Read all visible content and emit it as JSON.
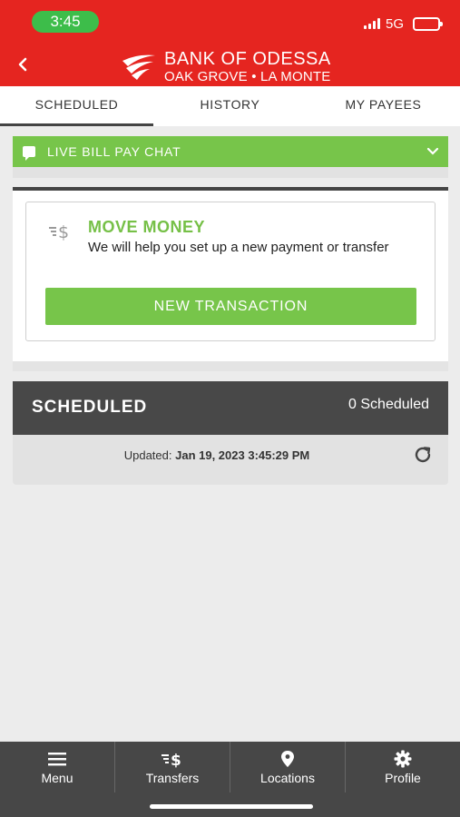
{
  "status_bar": {
    "time": "3:45",
    "network": "5G"
  },
  "header": {
    "bank_name": "BANK OF ODESSA",
    "bank_locations": "OAK GROVE • LA MONTE",
    "back_icon": "chevron-left-icon"
  },
  "tabs": [
    {
      "label": "SCHEDULED",
      "active": true
    },
    {
      "label": "HISTORY",
      "active": false
    },
    {
      "label": "MY PAYEES",
      "active": false
    }
  ],
  "chat": {
    "label": "LIVE BILL PAY CHAT"
  },
  "move_money": {
    "title": "MOVE MONEY",
    "subtitle": "We will help you set up a new payment or transfer",
    "button_label": "NEW TRANSACTION"
  },
  "scheduled": {
    "title": "SCHEDULED",
    "count": "0 Scheduled",
    "updated_prefix": "Updated:",
    "updated_value": "Jan 19, 2023 3:45:29 PM"
  },
  "bottom_nav": [
    {
      "label": "Menu",
      "icon": "hamburger-icon"
    },
    {
      "label": "Transfers",
      "icon": "transfers-icon"
    },
    {
      "label": "Locations",
      "icon": "location-pin-icon"
    },
    {
      "label": "Profile",
      "icon": "gear-icon"
    }
  ],
  "colors": {
    "brand_red": "#e52520",
    "accent_green": "#77c54a",
    "dark_panel": "#484848"
  }
}
